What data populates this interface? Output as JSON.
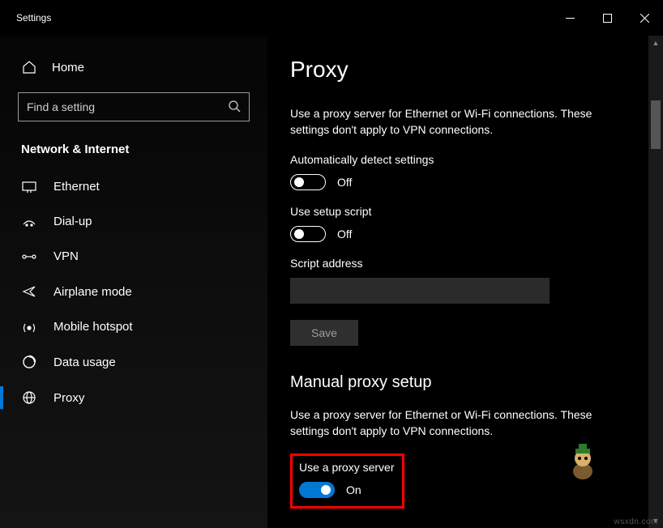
{
  "window": {
    "title": "Settings"
  },
  "sidebar": {
    "home": "Home",
    "search_placeholder": "Find a setting",
    "section": "Network & Internet",
    "items": [
      {
        "label": "Ethernet",
        "icon": "ethernet-icon"
      },
      {
        "label": "Dial-up",
        "icon": "dialup-icon"
      },
      {
        "label": "VPN",
        "icon": "vpn-icon"
      },
      {
        "label": "Airplane mode",
        "icon": "airplane-icon"
      },
      {
        "label": "Mobile hotspot",
        "icon": "hotspot-icon"
      },
      {
        "label": "Data usage",
        "icon": "data-usage-icon"
      },
      {
        "label": "Proxy",
        "icon": "globe-icon"
      }
    ],
    "selected_index": 6
  },
  "main": {
    "title": "Proxy",
    "desc1": "Use a proxy server for Ethernet or Wi-Fi connections. These settings don't apply to VPN connections.",
    "auto_detect": {
      "label": "Automatically detect settings",
      "state": "Off",
      "on": false
    },
    "setup_script": {
      "label": "Use setup script",
      "state": "Off",
      "on": false
    },
    "script_address": {
      "label": "Script address",
      "value": ""
    },
    "save_label": "Save",
    "manual_heading": "Manual proxy setup",
    "desc2": "Use a proxy server for Ethernet or Wi-Fi connections. These settings don't apply to VPN connections.",
    "use_proxy": {
      "label": "Use a proxy server",
      "state": "On",
      "on": true
    }
  },
  "watermark": "wsxdn.com"
}
